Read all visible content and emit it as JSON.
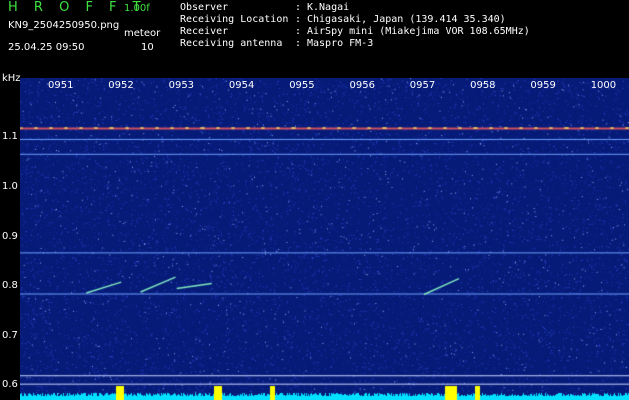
{
  "header": {
    "app_title": "H R O F F T",
    "version": "1.00f",
    "filename": "KN9_2504250950.png",
    "meteor_label": "meteor",
    "datetime": "25.04.25 09:50",
    "meteor_count": "10"
  },
  "metadata": [
    {
      "key": "Observer",
      "sep": ":",
      "value": "K.Nagai"
    },
    {
      "key": "Receiving Location",
      "sep": ":",
      "value": "Chigasaki, Japan (139.414 35.340)"
    },
    {
      "key": "Receiver",
      "sep": ":",
      "value": "AirSpy mini (Miakejima VOR 108.65MHz)"
    },
    {
      "key": "Receiving antenna",
      "sep": ":",
      "value": "Maspro FM-3"
    }
  ],
  "axis": {
    "unit": "kHz",
    "y_ticks": [
      "1.1",
      "1.0",
      "0.9",
      "0.8",
      "0.7",
      "0.6"
    ],
    "x_ticks": [
      "0951",
      "0952",
      "0953",
      "0954",
      "0955",
      "0956",
      "0957",
      "0958",
      "0959",
      "1000"
    ]
  },
  "colors": {
    "background": "#061a78",
    "label_green": "#3fe03f",
    "text": "#ffffff",
    "carrier": "#d05060",
    "meteor": "#7fe8c0",
    "baseline": "#00e0ff",
    "burst": "#ffff00"
  },
  "chart_data": {
    "type": "heatmap",
    "x": [
      "0951",
      "0952",
      "0953",
      "0954",
      "0955",
      "0956",
      "0957",
      "0958",
      "0959",
      "1000"
    ],
    "y_ticks": [
      1.1,
      1.0,
      0.9,
      0.8,
      0.7,
      0.6
    ],
    "ylabel": "kHz",
    "ylim": [
      0.57,
      1.22
    ],
    "carrier_lines_khz": [
      1.12,
      1.097,
      1.067,
      0.868,
      0.785,
      0.62,
      0.603
    ],
    "meteor_echoes": [
      {
        "time": "0951.8",
        "khz_start": 0.786,
        "khz_end": 0.808
      },
      {
        "time": "0952.7",
        "khz_start": 0.788,
        "khz_end": 0.818
      },
      {
        "time": "0953.3",
        "khz_start": 0.795,
        "khz_end": 0.805
      },
      {
        "time": "0957.4",
        "khz_start": 0.783,
        "khz_end": 0.815
      }
    ]
  }
}
